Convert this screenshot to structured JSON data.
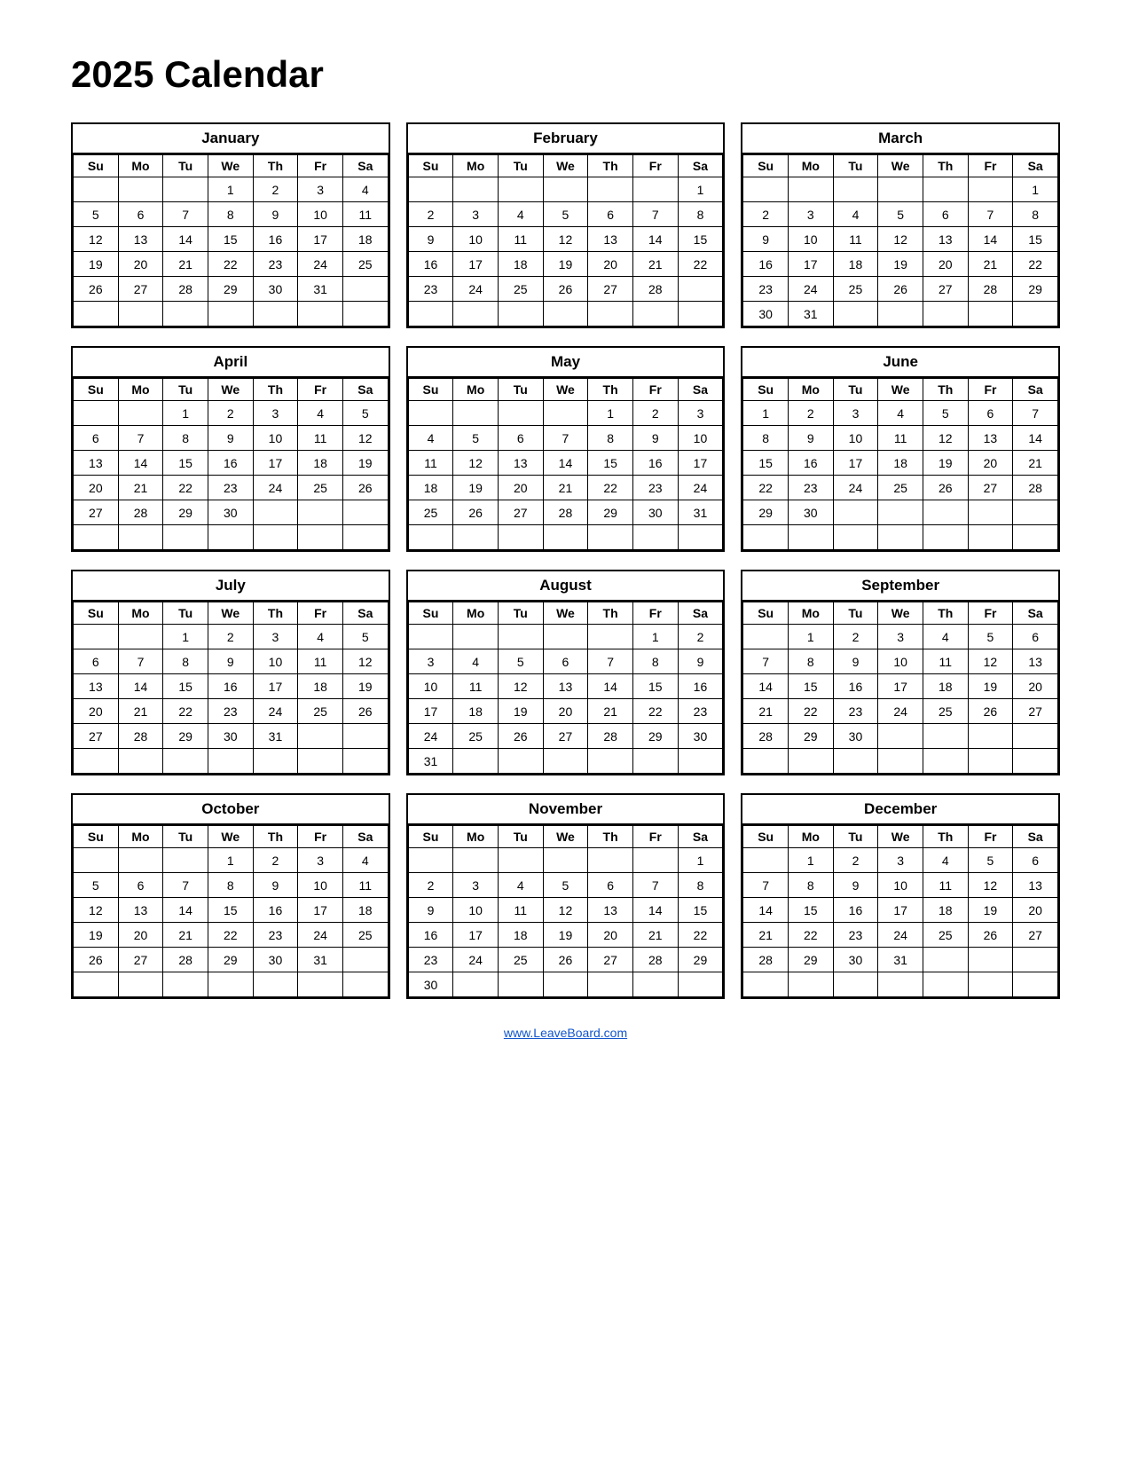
{
  "title": "2025 Calendar",
  "footer": "www.LeaveBoard.com",
  "months": [
    {
      "name": "January",
      "days": [
        "Su",
        "Mo",
        "Tu",
        "We",
        "Th",
        "Fr",
        "Sa"
      ],
      "weeks": [
        [
          "",
          "",
          "",
          "1",
          "2",
          "3",
          "4"
        ],
        [
          "5",
          "6",
          "7",
          "8",
          "9",
          "10",
          "11"
        ],
        [
          "12",
          "13",
          "14",
          "15",
          "16",
          "17",
          "18"
        ],
        [
          "19",
          "20",
          "21",
          "22",
          "23",
          "24",
          "25"
        ],
        [
          "26",
          "27",
          "28",
          "29",
          "30",
          "31",
          ""
        ],
        [
          "",
          "",
          "",
          "",
          "",
          "",
          ""
        ]
      ]
    },
    {
      "name": "February",
      "days": [
        "Su",
        "Mo",
        "Tu",
        "We",
        "Th",
        "Fr",
        "Sa"
      ],
      "weeks": [
        [
          "",
          "",
          "",
          "",
          "",
          "",
          "1"
        ],
        [
          "2",
          "3",
          "4",
          "5",
          "6",
          "7",
          "8"
        ],
        [
          "9",
          "10",
          "11",
          "12",
          "13",
          "14",
          "15"
        ],
        [
          "16",
          "17",
          "18",
          "19",
          "20",
          "21",
          "22"
        ],
        [
          "23",
          "24",
          "25",
          "26",
          "27",
          "28",
          ""
        ],
        [
          "",
          "",
          "",
          "",
          "",
          "",
          ""
        ]
      ]
    },
    {
      "name": "March",
      "days": [
        "Su",
        "Mo",
        "Tu",
        "We",
        "Th",
        "Fr",
        "Sa"
      ],
      "weeks": [
        [
          "",
          "",
          "",
          "",
          "",
          "",
          "1"
        ],
        [
          "2",
          "3",
          "4",
          "5",
          "6",
          "7",
          "8"
        ],
        [
          "9",
          "10",
          "11",
          "12",
          "13",
          "14",
          "15"
        ],
        [
          "16",
          "17",
          "18",
          "19",
          "20",
          "21",
          "22"
        ],
        [
          "23",
          "24",
          "25",
          "26",
          "27",
          "28",
          "29"
        ],
        [
          "30",
          "31",
          "",
          "",
          "",
          "",
          ""
        ]
      ]
    },
    {
      "name": "April",
      "days": [
        "Su",
        "Mo",
        "Tu",
        "We",
        "Th",
        "Fr",
        "Sa"
      ],
      "weeks": [
        [
          "",
          "",
          "1",
          "2",
          "3",
          "4",
          "5"
        ],
        [
          "6",
          "7",
          "8",
          "9",
          "10",
          "11",
          "12"
        ],
        [
          "13",
          "14",
          "15",
          "16",
          "17",
          "18",
          "19"
        ],
        [
          "20",
          "21",
          "22",
          "23",
          "24",
          "25",
          "26"
        ],
        [
          "27",
          "28",
          "29",
          "30",
          "",
          "",
          ""
        ],
        [
          "",
          "",
          "",
          "",
          "",
          "",
          ""
        ]
      ]
    },
    {
      "name": "May",
      "days": [
        "Su",
        "Mo",
        "Tu",
        "We",
        "Th",
        "Fr",
        "Sa"
      ],
      "weeks": [
        [
          "",
          "",
          "",
          "",
          "1",
          "2",
          "3"
        ],
        [
          "4",
          "5",
          "6",
          "7",
          "8",
          "9",
          "10"
        ],
        [
          "11",
          "12",
          "13",
          "14",
          "15",
          "16",
          "17"
        ],
        [
          "18",
          "19",
          "20",
          "21",
          "22",
          "23",
          "24"
        ],
        [
          "25",
          "26",
          "27",
          "28",
          "29",
          "30",
          "31"
        ],
        [
          "",
          "",
          "",
          "",
          "",
          "",
          ""
        ]
      ]
    },
    {
      "name": "June",
      "days": [
        "Su",
        "Mo",
        "Tu",
        "We",
        "Th",
        "Fr",
        "Sa"
      ],
      "weeks": [
        [
          "1",
          "2",
          "3",
          "4",
          "5",
          "6",
          "7"
        ],
        [
          "8",
          "9",
          "10",
          "11",
          "12",
          "13",
          "14"
        ],
        [
          "15",
          "16",
          "17",
          "18",
          "19",
          "20",
          "21"
        ],
        [
          "22",
          "23",
          "24",
          "25",
          "26",
          "27",
          "28"
        ],
        [
          "29",
          "30",
          "",
          "",
          "",
          "",
          ""
        ],
        [
          "",
          "",
          "",
          "",
          "",
          "",
          ""
        ]
      ]
    },
    {
      "name": "July",
      "days": [
        "Su",
        "Mo",
        "Tu",
        "We",
        "Th",
        "Fr",
        "Sa"
      ],
      "weeks": [
        [
          "",
          "",
          "1",
          "2",
          "3",
          "4",
          "5"
        ],
        [
          "6",
          "7",
          "8",
          "9",
          "10",
          "11",
          "12"
        ],
        [
          "13",
          "14",
          "15",
          "16",
          "17",
          "18",
          "19"
        ],
        [
          "20",
          "21",
          "22",
          "23",
          "24",
          "25",
          "26"
        ],
        [
          "27",
          "28",
          "29",
          "30",
          "31",
          "",
          ""
        ],
        [
          "",
          "",
          "",
          "",
          "",
          "",
          ""
        ]
      ]
    },
    {
      "name": "August",
      "days": [
        "Su",
        "Mo",
        "Tu",
        "We",
        "Th",
        "Fr",
        "Sa"
      ],
      "weeks": [
        [
          "",
          "",
          "",
          "",
          "",
          "1",
          "2"
        ],
        [
          "3",
          "4",
          "5",
          "6",
          "7",
          "8",
          "9"
        ],
        [
          "10",
          "11",
          "12",
          "13",
          "14",
          "15",
          "16"
        ],
        [
          "17",
          "18",
          "19",
          "20",
          "21",
          "22",
          "23"
        ],
        [
          "24",
          "25",
          "26",
          "27",
          "28",
          "29",
          "30"
        ],
        [
          "31",
          "",
          "",
          "",
          "",
          "",
          ""
        ]
      ]
    },
    {
      "name": "September",
      "days": [
        "Su",
        "Mo",
        "Tu",
        "We",
        "Th",
        "Fr",
        "Sa"
      ],
      "weeks": [
        [
          "",
          "1",
          "2",
          "3",
          "4",
          "5",
          "6"
        ],
        [
          "7",
          "8",
          "9",
          "10",
          "11",
          "12",
          "13"
        ],
        [
          "14",
          "15",
          "16",
          "17",
          "18",
          "19",
          "20"
        ],
        [
          "21",
          "22",
          "23",
          "24",
          "25",
          "26",
          "27"
        ],
        [
          "28",
          "29",
          "30",
          "",
          "",
          "",
          ""
        ],
        [
          "",
          "",
          "",
          "",
          "",
          "",
          ""
        ]
      ]
    },
    {
      "name": "October",
      "days": [
        "Su",
        "Mo",
        "Tu",
        "We",
        "Th",
        "Fr",
        "Sa"
      ],
      "weeks": [
        [
          "",
          "",
          "",
          "1",
          "2",
          "3",
          "4"
        ],
        [
          "5",
          "6",
          "7",
          "8",
          "9",
          "10",
          "11"
        ],
        [
          "12",
          "13",
          "14",
          "15",
          "16",
          "17",
          "18"
        ],
        [
          "19",
          "20",
          "21",
          "22",
          "23",
          "24",
          "25"
        ],
        [
          "26",
          "27",
          "28",
          "29",
          "30",
          "31",
          ""
        ],
        [
          "",
          "",
          "",
          "",
          "",
          "",
          ""
        ]
      ]
    },
    {
      "name": "November",
      "days": [
        "Su",
        "Mo",
        "Tu",
        "We",
        "Th",
        "Fr",
        "Sa"
      ],
      "weeks": [
        [
          "",
          "",
          "",
          "",
          "",
          "",
          "1"
        ],
        [
          "2",
          "3",
          "4",
          "5",
          "6",
          "7",
          "8"
        ],
        [
          "9",
          "10",
          "11",
          "12",
          "13",
          "14",
          "15"
        ],
        [
          "16",
          "17",
          "18",
          "19",
          "20",
          "21",
          "22"
        ],
        [
          "23",
          "24",
          "25",
          "26",
          "27",
          "28",
          "29"
        ],
        [
          "30",
          "",
          "",
          "",
          "",
          "",
          ""
        ]
      ]
    },
    {
      "name": "December",
      "days": [
        "Su",
        "Mo",
        "Tu",
        "We",
        "Th",
        "Fr",
        "Sa"
      ],
      "weeks": [
        [
          "",
          "1",
          "2",
          "3",
          "4",
          "5",
          "6"
        ],
        [
          "7",
          "8",
          "9",
          "10",
          "11",
          "12",
          "13"
        ],
        [
          "14",
          "15",
          "16",
          "17",
          "18",
          "19",
          "20"
        ],
        [
          "21",
          "22",
          "23",
          "24",
          "25",
          "26",
          "27"
        ],
        [
          "28",
          "29",
          "30",
          "31",
          "",
          "",
          ""
        ],
        [
          "",
          "",
          "",
          "",
          "",
          "",
          ""
        ]
      ]
    }
  ]
}
